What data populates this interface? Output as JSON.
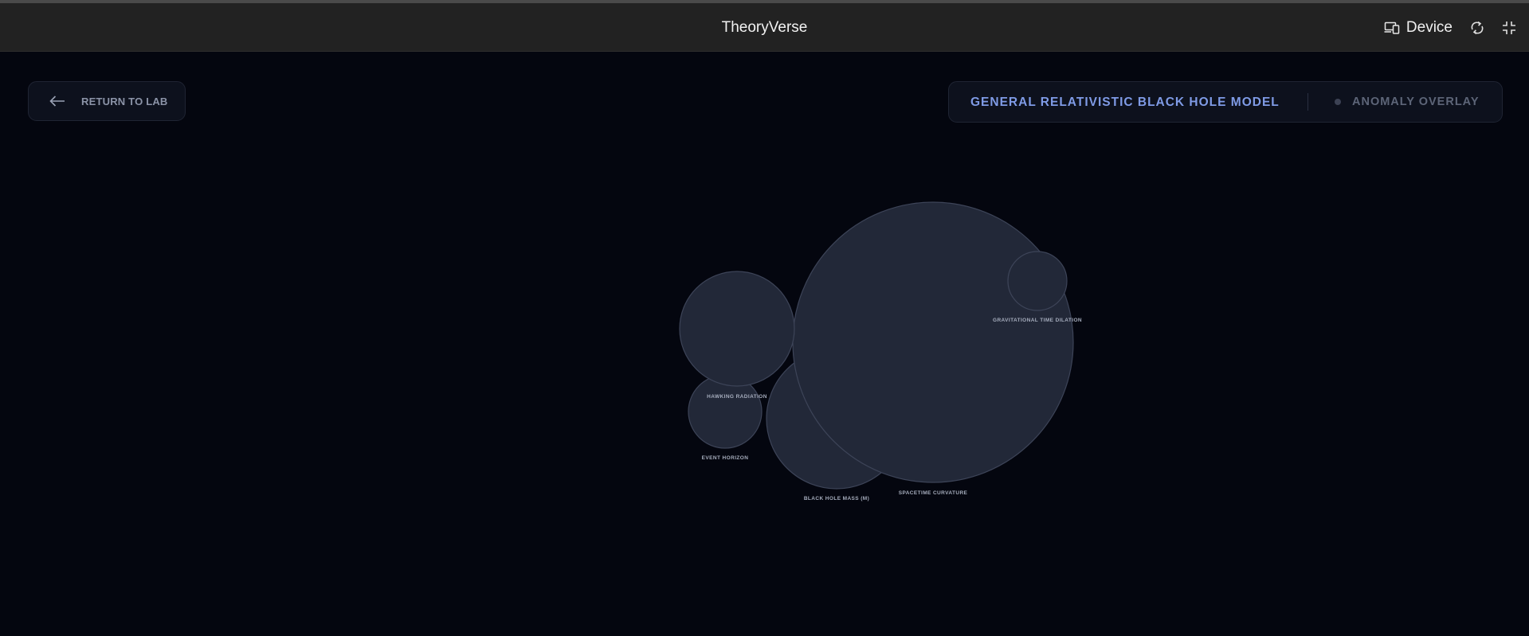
{
  "app": {
    "title": "TheoryVerse"
  },
  "toolbar": {
    "device_label": "Device",
    "icons": [
      "device-icon",
      "rotate-icon",
      "exit-fullscreen-icon"
    ]
  },
  "nav": {
    "return_label": "RETURN TO LAB",
    "return_icon": "arrow-left-icon"
  },
  "model": {
    "title": "GENERAL RELATIVISTIC BLACK HOLE MODEL",
    "overlay_label": "ANOMALY OVERLAY",
    "overlay_active": false
  },
  "colors": {
    "background": "#04060f",
    "accent": "#7f9be6",
    "bubble_fill": "#222838",
    "bubble_stroke": "#3d4458"
  },
  "concepts": [
    {
      "label": "SPACETIME CURVATURE"
    },
    {
      "label": "BLACK HOLE MASS (M)"
    },
    {
      "label": "HAWKING RADIATION"
    },
    {
      "label": "EVENT HORIZON"
    },
    {
      "label": "GRAVITATIONAL TIME DILATION"
    }
  ]
}
